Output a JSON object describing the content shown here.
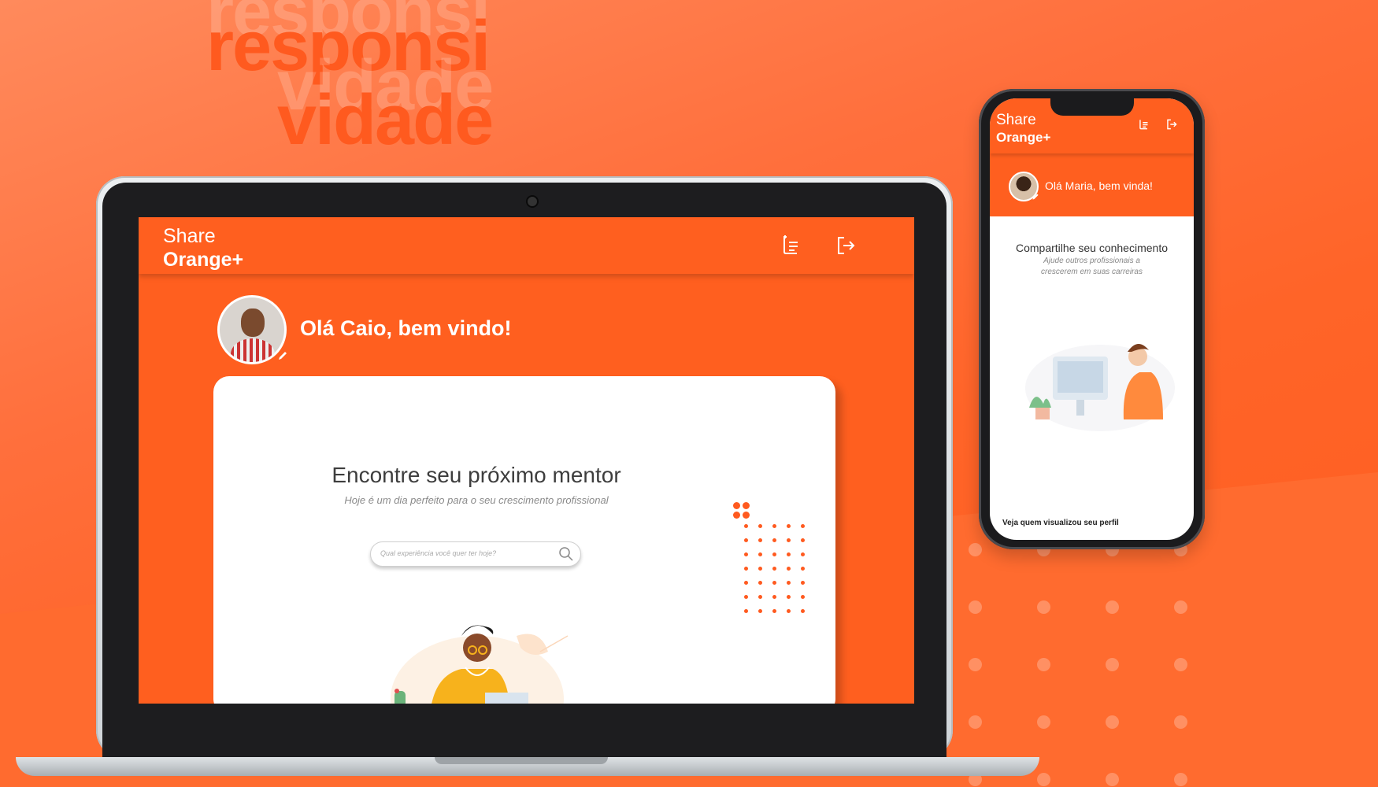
{
  "hero": {
    "line1": "responsi",
    "line2": "vidade"
  },
  "laptop": {
    "app": {
      "logo_line1": "Share",
      "logo_line2": "Orange+"
    },
    "greeting": "Olá Caio,  bem vindo!",
    "card": {
      "title": "Encontre seu próximo mentor",
      "subtitle": "Hoje é um dia perfeito para o seu crescimento profissional",
      "search_placeholder": "Qual experiência você quer ter hoje?"
    }
  },
  "phone": {
    "app": {
      "logo_line1": "Share",
      "logo_line2": "Orange+"
    },
    "greeting": "Olá Maria, bem vinda!",
    "section_title": "Compartilhe seu conhecimento",
    "section_subtitle_line1": "Ajude outros profissionais a",
    "section_subtitle_line2": "crescerem em suas carreiras",
    "footer_link": "Veja quem visualizou seu perfil"
  },
  "colors": {
    "brand_orange": "#ff5f1f",
    "text_dark": "#3d3d3d"
  }
}
